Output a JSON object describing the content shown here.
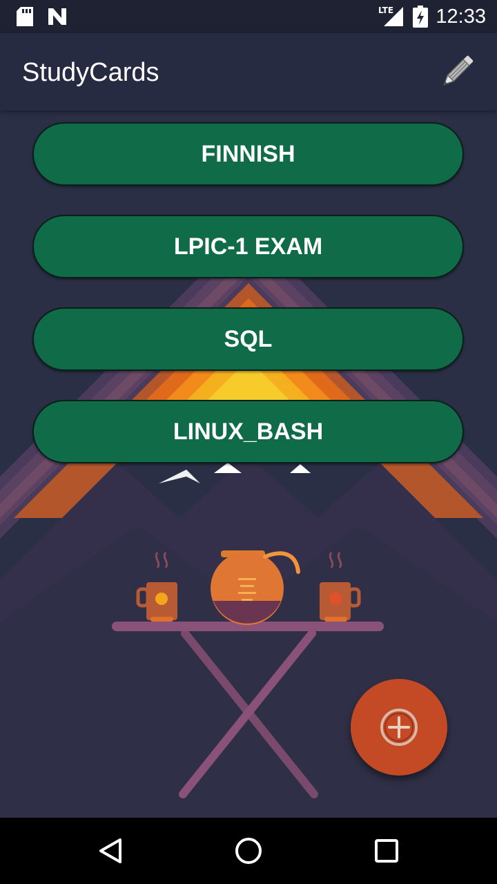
{
  "status_bar": {
    "time": "12:33",
    "network": "LTE",
    "icons": [
      "sd-card-icon",
      "n-notification-icon",
      "lte-signal-icon",
      "battery-charging-icon"
    ]
  },
  "app_bar": {
    "title": "StudyCards",
    "edit_icon": "pencil-icon"
  },
  "decks": [
    {
      "label": "FINNISH"
    },
    {
      "label": "LPIC-1 EXAM"
    },
    {
      "label": "SQL"
    },
    {
      "label": "LINUX_BASH"
    }
  ],
  "fab": {
    "icon": "add-circle-icon"
  },
  "nav_bar": {
    "icons": [
      "back-icon",
      "home-icon",
      "recents-icon"
    ]
  },
  "colors": {
    "background": "#2b2f45",
    "app_bar": "#272b41",
    "deck_button": "#0f6b48",
    "fab": "#c44a26"
  }
}
